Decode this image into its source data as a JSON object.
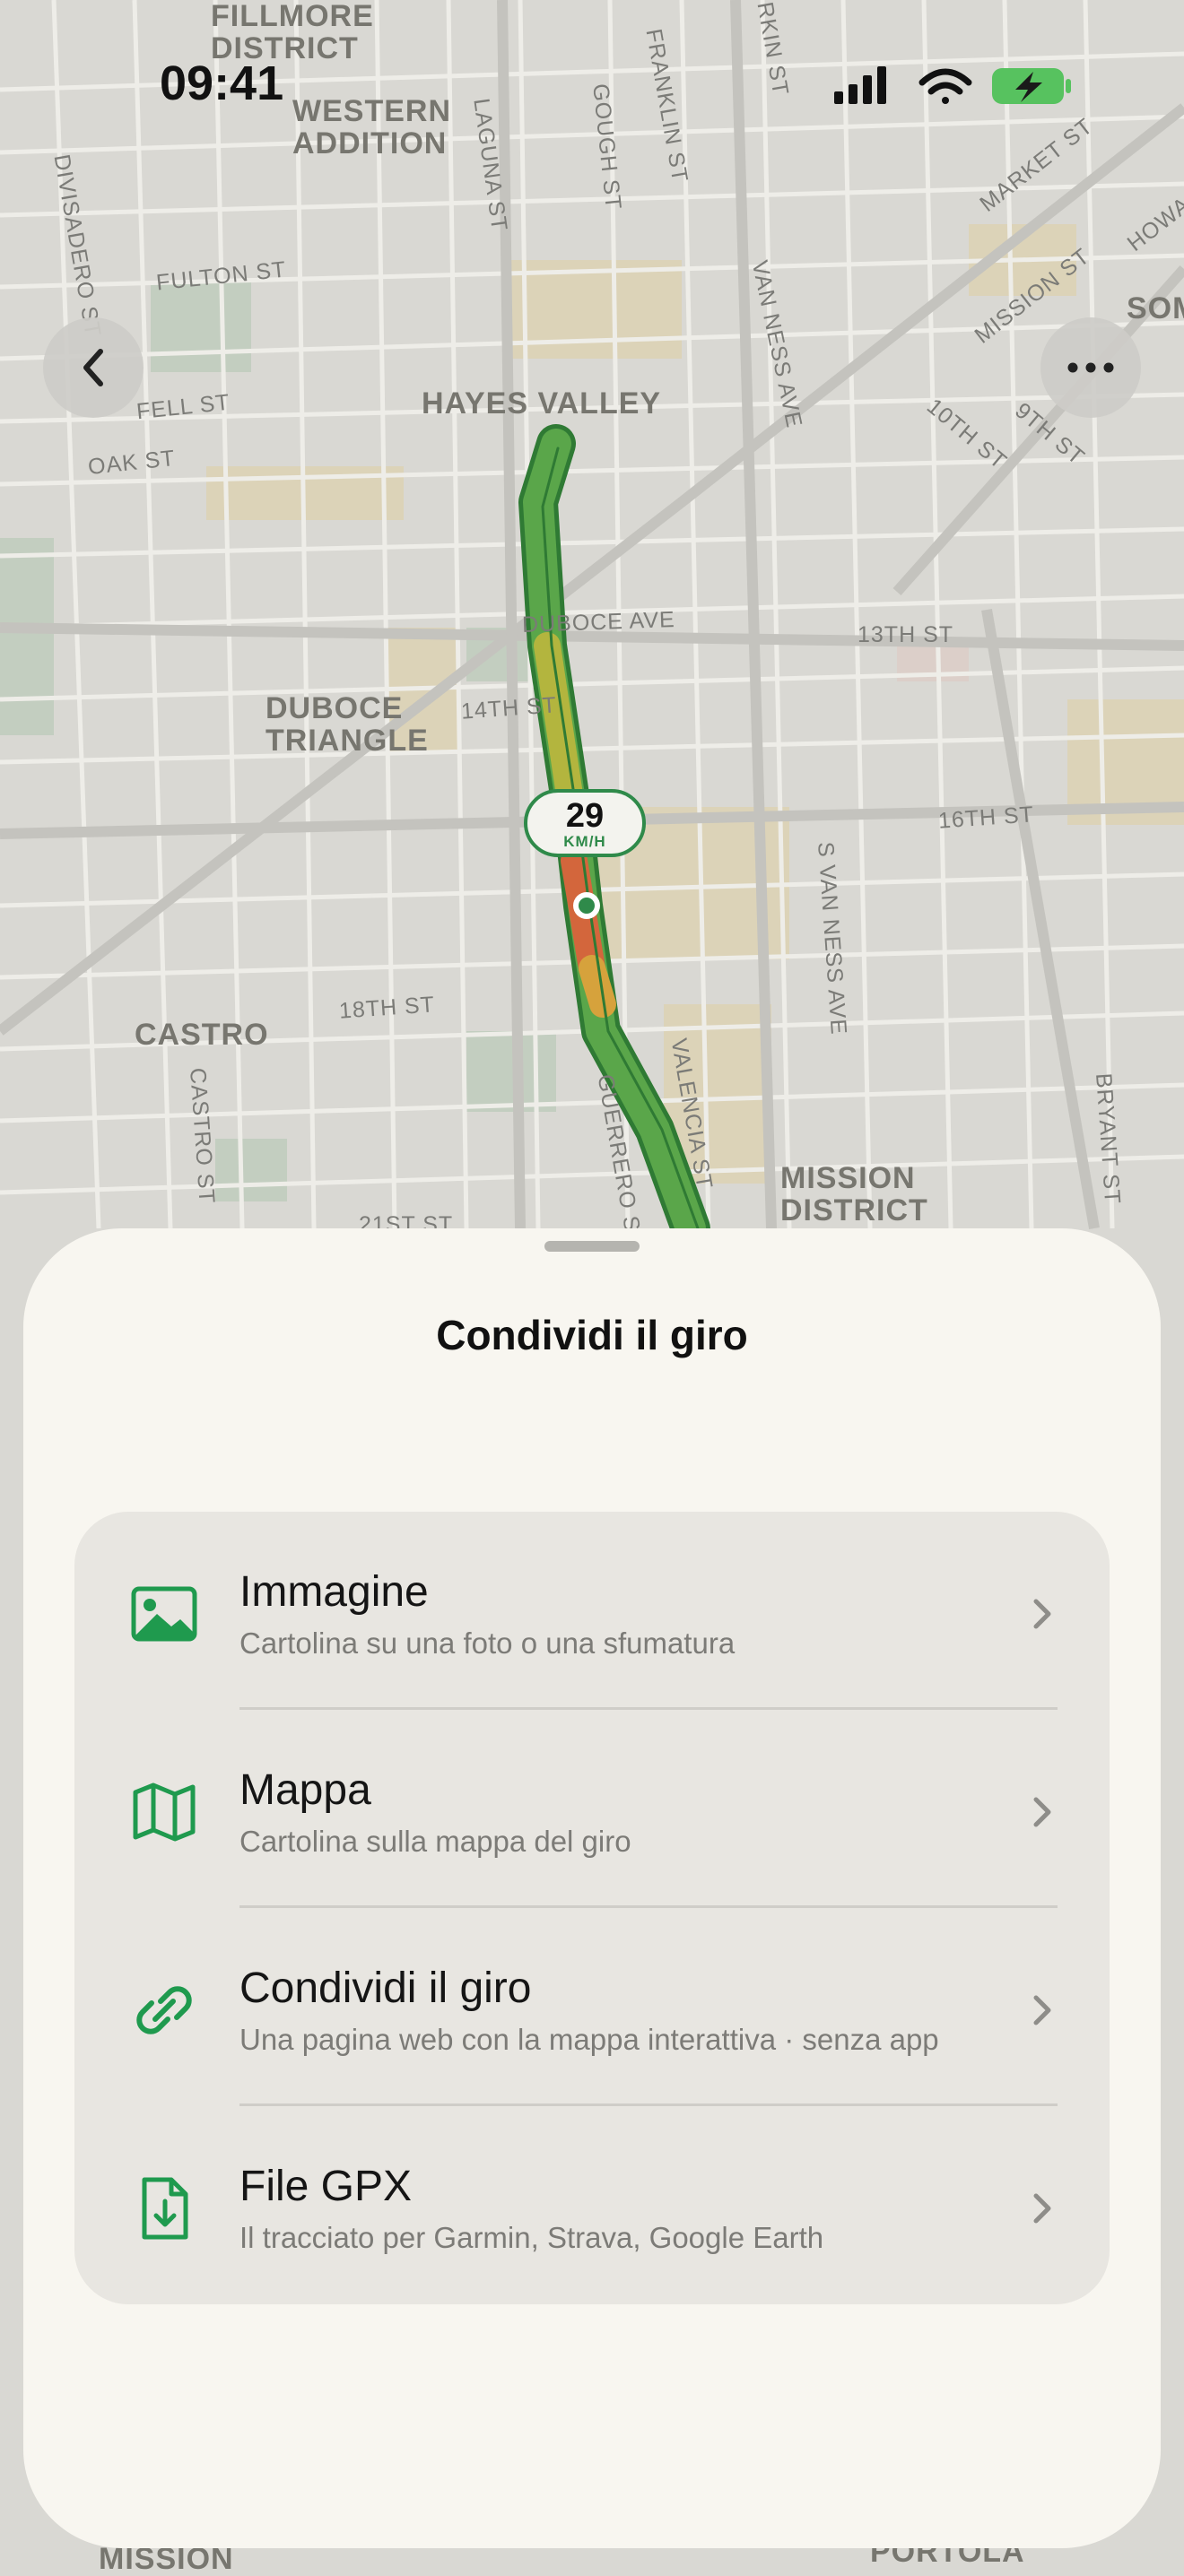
{
  "status_bar": {
    "time": "09:41"
  },
  "map": {
    "labels": [
      "FILLMORE\nDISTRICT",
      "WESTERN\nADDITION",
      "LAGUNA ST",
      "GOUGH ST",
      "FRANKLIN ST",
      "DIVISADERO ST",
      "FULTON ST",
      "FELL ST",
      "OAK ST",
      "HAYES VALLEY",
      "VAN NESS AVE",
      "MISSION ST",
      "MARKET ST",
      "10TH ST",
      "9TH ST",
      "SOM",
      "DUBOCE AVE",
      "13TH ST",
      "DUBOCE\nTRIANGLE",
      "14TH ST",
      "16TH ST",
      "S VAN NESS AVE",
      "CASTRO",
      "18TH ST",
      "CASTRO ST",
      "GUERRERO ST",
      "VALENCIA ST",
      "MISSION\nDISTRICT",
      "BRYANT ST",
      "21ST ST",
      "MISSION",
      "PORTOLA",
      "RKIN ST",
      "HOWA"
    ],
    "speed": {
      "value": "29",
      "unit": "KM/H"
    }
  },
  "buttons": {
    "back_icon": "chevron-left-icon",
    "more_icon": "ellipsis-icon"
  },
  "sheet": {
    "title": "Condividi il giro",
    "options": [
      {
        "icon": "image-icon",
        "title": "Immagine",
        "subtitle": "Cartolina su una foto o una sfumatura"
      },
      {
        "icon": "map-icon",
        "title": "Mappa",
        "subtitle": "Cartolina sulla mappa del giro"
      },
      {
        "icon": "link-icon",
        "title": "Condividi il giro",
        "subtitle": "Una pagina web con la mappa interattiva · senza app"
      },
      {
        "icon": "file-download-icon",
        "title": "File GPX",
        "subtitle": "Il tracciato per Garmin, Strava, Google Earth"
      }
    ]
  },
  "colors": {
    "accent": "#1f9a4e",
    "route_green": "#4f9a3f",
    "route_yellow": "#b9b23a",
    "route_red": "#d0543a"
  }
}
